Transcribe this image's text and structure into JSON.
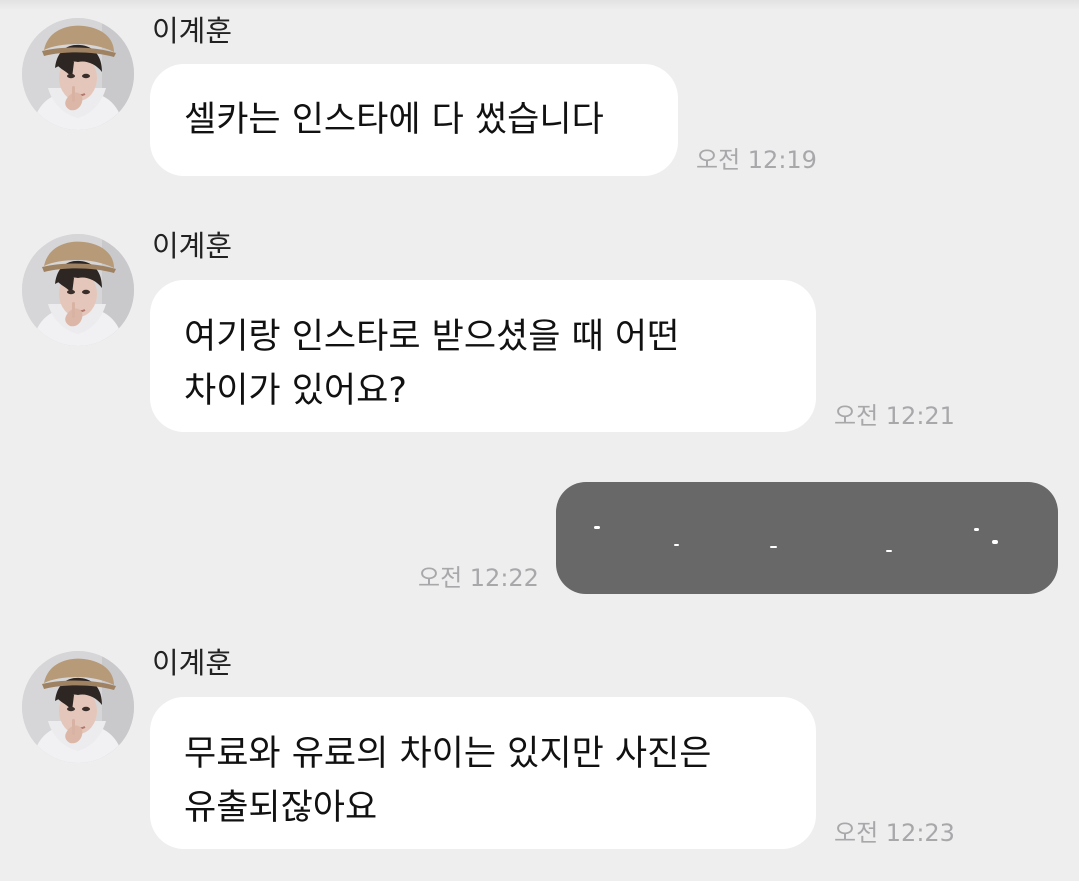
{
  "chat": {
    "messages": [
      {
        "sender": "이계훈",
        "lines": [
          "셀카는 인스타에 다 썼습니다"
        ],
        "time": "오전 12:19"
      },
      {
        "sender": "이계훈",
        "lines": [
          "여기랑 인스타로 받으셨을 때 어떤",
          "차이가 있어요?"
        ],
        "time": "오전 12:21"
      },
      {
        "own": true,
        "redacted": true,
        "time": "오전 12:22"
      },
      {
        "sender": "이계훈",
        "lines": [
          "무료와 유료의 차이는 있지만 사진은",
          "유출되잖아요"
        ],
        "time": "오전 12:23"
      }
    ]
  },
  "colors": {
    "background": "#eeeeef",
    "incoming_bubble": "#ffffff",
    "outgoing_bubble_redacted": "#686868",
    "timestamp": "#a8a8ab"
  },
  "icons": {
    "avatar": "profile-photo"
  }
}
